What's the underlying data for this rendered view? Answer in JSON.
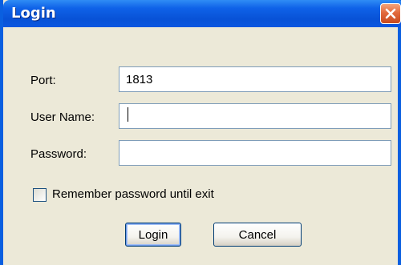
{
  "window": {
    "title": "Login"
  },
  "form": {
    "port_label": "Port:",
    "port_value": "1813",
    "username_label": "User Name:",
    "username_value": "",
    "password_label": "Password:",
    "password_value": "",
    "remember_label": "Remember password until exit",
    "remember_checked": false
  },
  "buttons": {
    "login_label": "Login",
    "cancel_label": "Cancel"
  },
  "icons": {
    "close": "close-icon"
  },
  "colors": {
    "titlebar": "#0a57e0",
    "close_button": "#e26a3d",
    "dialog_background": "#ece9d8"
  }
}
